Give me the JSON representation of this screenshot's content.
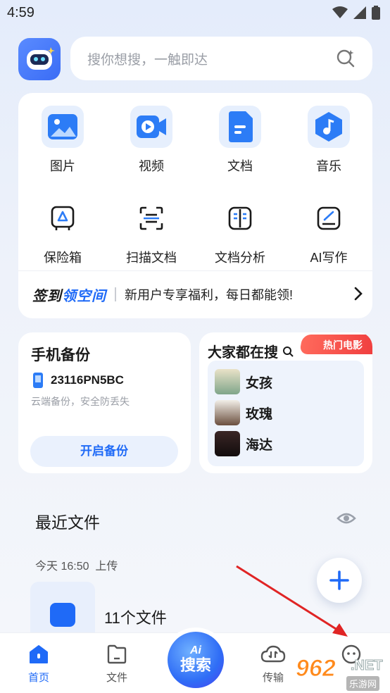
{
  "status": {
    "time": "4:59"
  },
  "search": {
    "placeholder": "搜你想搜，一触即达"
  },
  "tools": [
    {
      "label": "图片",
      "icon": "image-icon"
    },
    {
      "label": "视频",
      "icon": "video-icon"
    },
    {
      "label": "文档",
      "icon": "document-icon"
    },
    {
      "label": "音乐",
      "icon": "music-icon"
    },
    {
      "label": "保险箱",
      "icon": "safe-icon"
    },
    {
      "label": "扫描文档",
      "icon": "scan-icon"
    },
    {
      "label": "文档分析",
      "icon": "doc-analysis-icon"
    },
    {
      "label": "AI写作",
      "icon": "ai-write-icon"
    }
  ],
  "promo": {
    "brand_a": "签到",
    "brand_b": "领空间",
    "text": "新用户专享福利，每日都能领!"
  },
  "backup": {
    "title": "手机备份",
    "device": "23116PN5BC",
    "subtitle": "云端备份，安全防丢失",
    "button": "开启备份"
  },
  "hot": {
    "title": "大家都在搜",
    "tag": "热门电影",
    "items": [
      {
        "name": "女孩"
      },
      {
        "name": "玫瑰"
      },
      {
        "name": "海达"
      }
    ]
  },
  "recent": {
    "title": "最近文件",
    "date": "今天 16:50",
    "action": "上传",
    "count": "11个文件"
  },
  "nav": {
    "home": "首页",
    "files": "文件",
    "center_ai": "Ai",
    "center": "搜索",
    "transfer": "传输",
    "watermark_num": "962",
    "watermark_net": ".NET",
    "watermark_cn": "乐游网"
  },
  "colors": {
    "accent": "#1f6af7",
    "hot_tag": "#f03f3f",
    "arrow": "#e02424"
  }
}
